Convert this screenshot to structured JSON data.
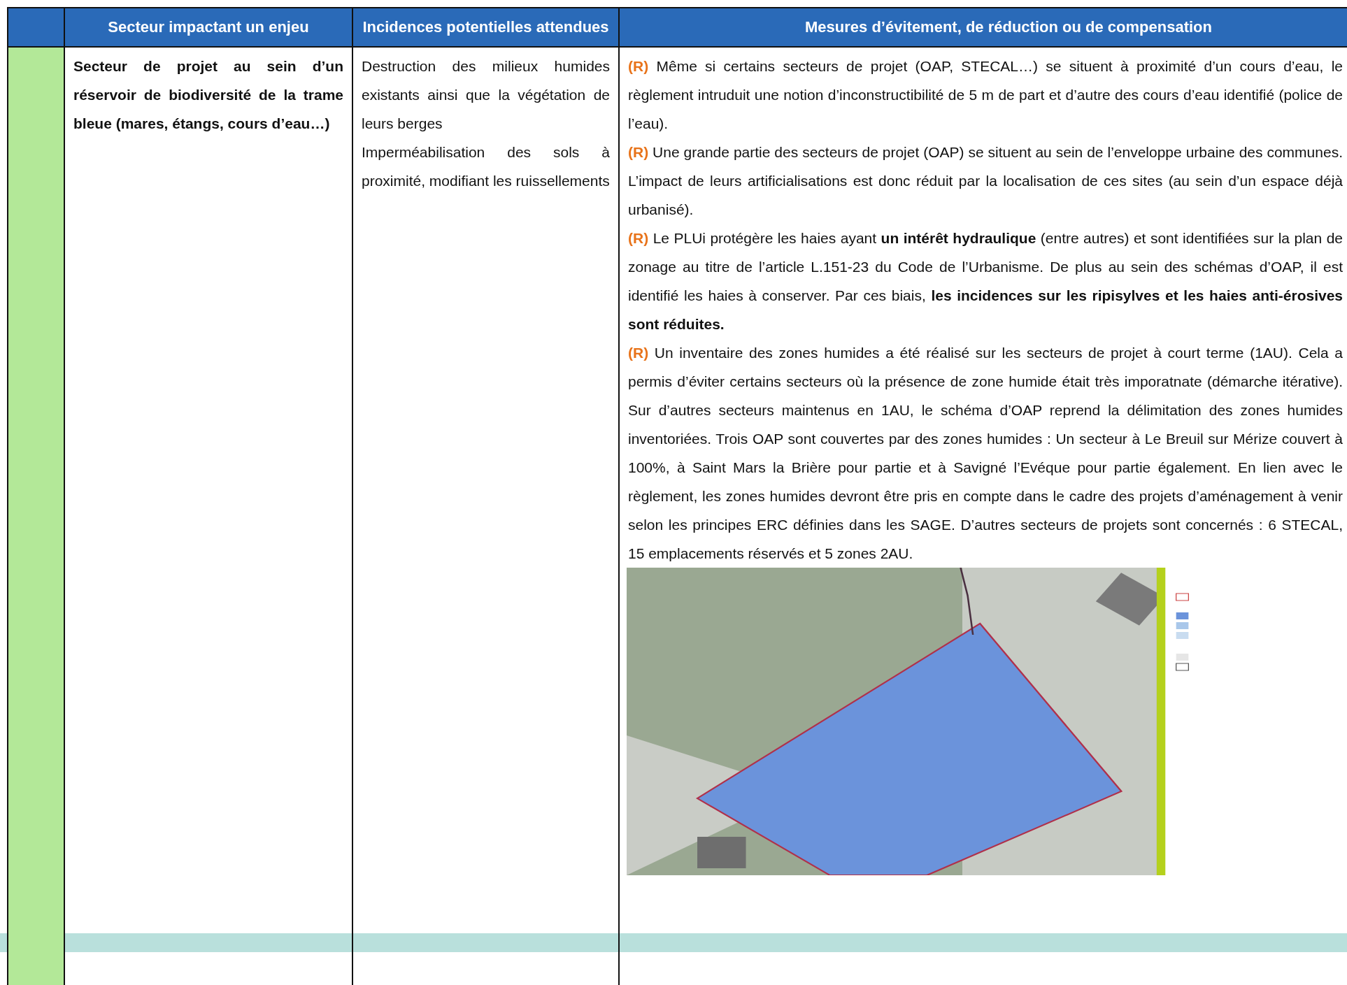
{
  "table": {
    "columns": [
      "Secteur impactant un enjeu",
      "Incidences potentielles attendues",
      "Mesures d’évitement, de réduction ou de compensation"
    ],
    "rows": [
      {
        "color": "#b3e898",
        "sector": "Secteur de projet au sein d’un réservoir de biodiversité de la trame bleue (mares, étangs, cours d’eau…)",
        "impacts": [
          "Destruction des milieux humides existants ainsi que la végétation de leurs berges",
          "Imperméabilisation des sols à proximité, modifiant les ruissellements"
        ],
        "measures": [
          {
            "mark": "(R)",
            "text": "Même si certains secteurs de projet (OAP, STECAL…) se situent à proximité d’un cours d’eau, le règlement intruduit une notion d’inconstructibilité de 5 m de part et d’autre des cours d’eau identifié (police de l’eau)."
          },
          {
            "mark": "(R)",
            "text": "Une grande partie des secteurs de projet (OAP) se situent au sein de l’enveloppe urbaine des communes. L’impact de leurs artificialisations est donc réduit par la localisation de ces sites (au sein d’un espace déjà urbanisé)."
          },
          {
            "mark": "(R)",
            "text": "Le PLUi protégère les haies ayant **un intérêt hydraulique** (entre autres) et sont identifiées sur la plan de zonage au titre de l’article L.151-23 du Code de l’Urbanisme. De plus au sein des schémas d’OAP, il est identifié les haies à conserver. Par ces biais, **les incidences sur les ripisylves et les haies anti-érosives sont réduites.**"
          },
          {
            "mark": "(R)",
            "text": "Un inventaire des zones humides a été réalisé sur les secteurs de projet à court terme (1AU). Cela a permis d’éviter certains secteurs où la présence de zone humide était très imporatnate (démarche itérative). Sur d’autres secteurs maintenus en 1AU, le schéma d’OAP reprend la délimitation des zones humides inventoriées. Trois OAP sont couvertes par des zones humides : Un secteur à Le Breuil sur Mérize couvert à 100%, à Saint Mars la Brière pour partie et à Savigné l’Evéque pour partie également. En lien avec le règlement, les zones humides devront être pris en compte dans le cadre des projets d’aménagement à venir selon les principes ERC définies dans les SAGE. D’autres secteurs de projets sont concernés : 6 STECAL, 15 emplacements réservés et 5 zones 2AU."
          }
        ]
      }
    ]
  }
}
